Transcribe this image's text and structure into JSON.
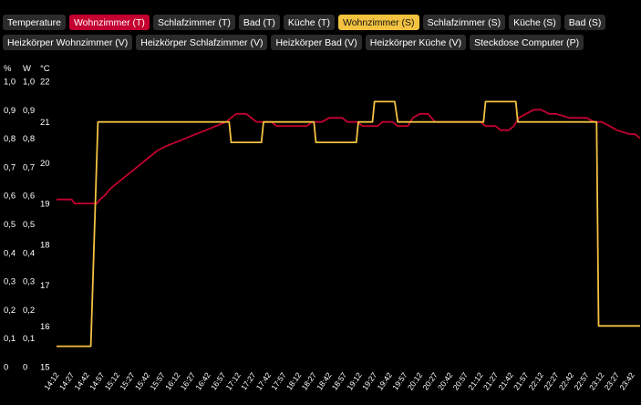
{
  "toggles": {
    "row1": [
      {
        "id": "temperature",
        "label": "Temperature",
        "state": "off"
      },
      {
        "id": "wohnzimmer-t",
        "label": "Wohnzimmer (T)",
        "state": "on-red"
      },
      {
        "id": "schlafzimmer-t",
        "label": "Schlafzimmer (T)",
        "state": "off"
      },
      {
        "id": "bad-t",
        "label": "Bad (T)",
        "state": "off"
      },
      {
        "id": "kueche-t",
        "label": "Küche (T)",
        "state": "off"
      },
      {
        "id": "wohnzimmer-s",
        "label": "Wohnzimmer (S)",
        "state": "on-yellow"
      },
      {
        "id": "schlafzimmer-s",
        "label": "Schlafzimmer (S)",
        "state": "off"
      },
      {
        "id": "kueche-s",
        "label": "Küche (S)",
        "state": "off"
      },
      {
        "id": "bad-s",
        "label": "Bad (S)",
        "state": "off"
      }
    ],
    "row2": [
      {
        "id": "heizkoerper-wohnzimmer-v",
        "label": "Heizkörper Wohnzimmer (V)",
        "state": "off"
      },
      {
        "id": "heizkoerper-schlafzimmer-v",
        "label": "Heizkörper Schlafzimmer (V)",
        "state": "off"
      },
      {
        "id": "heizkoerper-bad-v",
        "label": "Heizkörper Bad (V)",
        "state": "off"
      },
      {
        "id": "heizkoerper-kueche-v",
        "label": "Heizkörper Küche (V)",
        "state": "off"
      },
      {
        "id": "steckdose-computer-p",
        "label": "Steckdose Computer (P)",
        "state": "off"
      }
    ]
  },
  "colors": {
    "wohnzimmer_t": "#c3002f",
    "wohnzimmer_s": "#f3c241",
    "chip_off": "#2b2b2b",
    "background": "#000000"
  },
  "chart_data": {
    "type": "line",
    "axes": [
      {
        "unit": "%",
        "ticks": [
          "1,0",
          "0,9",
          "0,8",
          "0,7",
          "0,6",
          "0,5",
          "0,4",
          "0,3",
          "0,2",
          "0,1",
          "0"
        ],
        "range": [
          0,
          1
        ]
      },
      {
        "unit": "W",
        "ticks": [
          "1,0",
          "0,9",
          "0,8",
          "0,7",
          "0,6",
          "0,5",
          "0,4",
          "0,3",
          "0,2",
          "0,1",
          "0"
        ],
        "range": [
          0,
          1
        ]
      },
      {
        "unit": "°C",
        "ticks": [
          "22",
          "21",
          "20",
          "19",
          "18",
          "17",
          "16",
          "15"
        ],
        "range": [
          15,
          22
        ]
      }
    ],
    "x_labels": [
      "14:12",
      "14:27",
      "14:42",
      "14:57",
      "15:12",
      "15:27",
      "15:42",
      "15:57",
      "16:12",
      "16:27",
      "16:42",
      "16:57",
      "17:12",
      "17:27",
      "17:42",
      "17:57",
      "18:12",
      "18:27",
      "18:42",
      "18:57",
      "19:12",
      "19:27",
      "19:42",
      "19:57",
      "20:12",
      "20:27",
      "20:42",
      "20:57",
      "21:12",
      "21:27",
      "21:42",
      "21:57",
      "22:12",
      "22:27",
      "22:42",
      "22:57",
      "23:12",
      "23:27",
      "23:42"
    ],
    "series": [
      {
        "name": "Wohnzimmer (T)",
        "axis": "°C",
        "color": "#c3002f",
        "points": [
          [
            "14:12",
            19.1
          ],
          [
            "14:27",
            19.1
          ],
          [
            "14:30",
            19.0
          ],
          [
            "14:42",
            19.0
          ],
          [
            "14:52",
            19.0
          ],
          [
            "14:55",
            19.1
          ],
          [
            "15:00",
            19.2
          ],
          [
            "15:03",
            19.3
          ],
          [
            "15:07",
            19.4
          ],
          [
            "15:12",
            19.5
          ],
          [
            "15:17",
            19.6
          ],
          [
            "15:22",
            19.7
          ],
          [
            "15:27",
            19.8
          ],
          [
            "15:32",
            19.9
          ],
          [
            "15:37",
            20.0
          ],
          [
            "15:42",
            20.1
          ],
          [
            "15:47",
            20.2
          ],
          [
            "15:52",
            20.3
          ],
          [
            "16:00",
            20.4
          ],
          [
            "16:10",
            20.5
          ],
          [
            "16:20",
            20.6
          ],
          [
            "16:30",
            20.7
          ],
          [
            "16:40",
            20.8
          ],
          [
            "16:50",
            20.9
          ],
          [
            "17:00",
            21.0
          ],
          [
            "17:05",
            21.1
          ],
          [
            "17:10",
            21.2
          ],
          [
            "17:20",
            21.2
          ],
          [
            "17:25",
            21.1
          ],
          [
            "17:30",
            21.0
          ],
          [
            "17:45",
            21.0
          ],
          [
            "17:50",
            20.9
          ],
          [
            "18:05",
            20.9
          ],
          [
            "18:10",
            20.9
          ],
          [
            "18:20",
            20.9
          ],
          [
            "18:25",
            21.0
          ],
          [
            "18:35",
            21.0
          ],
          [
            "18:42",
            21.1
          ],
          [
            "18:55",
            21.1
          ],
          [
            "19:00",
            21.0
          ],
          [
            "19:10",
            21.0
          ],
          [
            "19:15",
            20.9
          ],
          [
            "19:30",
            20.9
          ],
          [
            "19:35",
            21.0
          ],
          [
            "19:45",
            21.0
          ],
          [
            "19:50",
            20.9
          ],
          [
            "20:00",
            20.9
          ],
          [
            "20:05",
            21.1
          ],
          [
            "20:12",
            21.2
          ],
          [
            "20:20",
            21.2
          ],
          [
            "20:27",
            21.0
          ],
          [
            "20:45",
            21.0
          ],
          [
            "20:50",
            21.0
          ],
          [
            "20:57",
            21.0
          ],
          [
            "21:00",
            21.0
          ],
          [
            "21:12",
            21.0
          ],
          [
            "21:17",
            20.9
          ],
          [
            "21:27",
            20.9
          ],
          [
            "21:32",
            20.8
          ],
          [
            "21:40",
            20.8
          ],
          [
            "21:45",
            20.9
          ],
          [
            "21:50",
            21.1
          ],
          [
            "21:57",
            21.2
          ],
          [
            "22:05",
            21.3
          ],
          [
            "22:12",
            21.3
          ],
          [
            "22:20",
            21.2
          ],
          [
            "22:27",
            21.2
          ],
          [
            "22:40",
            21.1
          ],
          [
            "22:57",
            21.1
          ],
          [
            "23:05",
            21.0
          ],
          [
            "23:12",
            21.0
          ],
          [
            "23:20",
            20.9
          ],
          [
            "23:27",
            20.8
          ],
          [
            "23:40",
            20.7
          ],
          [
            "23:45",
            20.7
          ],
          [
            "23:50",
            20.6
          ]
        ]
      },
      {
        "name": "Wohnzimmer (S)",
        "axis": "°C",
        "color": "#f3c241",
        "points": [
          [
            "14:12",
            15.5
          ],
          [
            "14:46",
            15.5
          ],
          [
            "14:53",
            21.0
          ],
          [
            "17:03",
            21.0
          ],
          [
            "17:05",
            20.5
          ],
          [
            "17:35",
            20.5
          ],
          [
            "17:37",
            21.0
          ],
          [
            "18:27",
            21.0
          ],
          [
            "18:29",
            20.5
          ],
          [
            "19:09",
            20.5
          ],
          [
            "19:11",
            21.0
          ],
          [
            "19:25",
            21.0
          ],
          [
            "19:27",
            21.5
          ],
          [
            "19:47",
            21.5
          ],
          [
            "19:50",
            21.0
          ],
          [
            "21:15",
            21.0
          ],
          [
            "21:17",
            21.5
          ],
          [
            "21:47",
            21.5
          ],
          [
            "21:49",
            21.0
          ],
          [
            "23:07",
            21.0
          ],
          [
            "23:09",
            16.0
          ],
          [
            "23:50",
            16.0
          ]
        ]
      }
    ]
  }
}
